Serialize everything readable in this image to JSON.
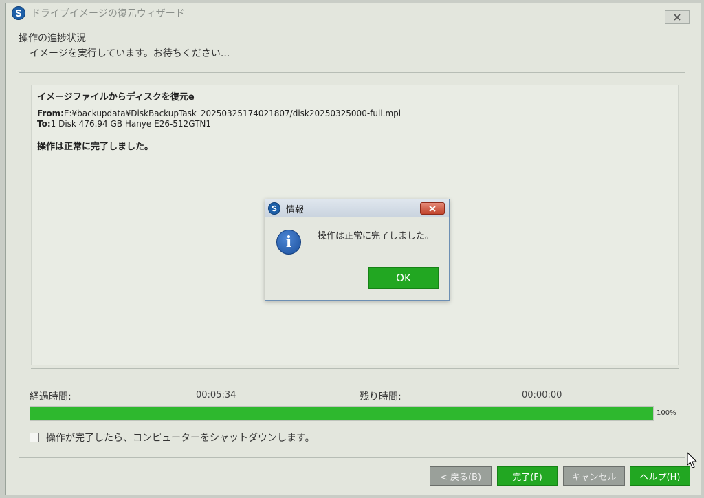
{
  "window": {
    "title": "ドライブイメージの復元ウィザード",
    "close_icon": "close-icon"
  },
  "header": {
    "title": "操作の進捗状況",
    "subtitle": "イメージを実行しています。お待ちください..."
  },
  "panel": {
    "operation_title": "イメージファイルからディスクを復元e",
    "from_label": "From:",
    "from_value": "E:¥backupdata¥DiskBackupTask_20250325174021807/disk20250325000-full.mpi",
    "to_label": "To:",
    "to_value": "1 Disk 476.94 GB Hanye E26-512GTN1",
    "status": "操作は正常に完了しました。"
  },
  "progress": {
    "elapsed_label": "経過時間:",
    "elapsed_value": "00:05:34",
    "remaining_label": "残り時間:",
    "remaining_value": "00:00:00",
    "percent": 100,
    "percent_text": "100%"
  },
  "shutdown_checkbox": {
    "label": "操作が完了したら、コンピューターをシャットダウンします。",
    "checked": false
  },
  "buttons": {
    "back": "< 戻る(B)",
    "finish": "完了(F)",
    "cancel": "キャンセル",
    "help": "ヘルプ(H)"
  },
  "dialog": {
    "title": "情報",
    "message": "操作は正常に完了しました。",
    "ok": "OK",
    "icon": "info-icon"
  },
  "colors": {
    "progress_fill": "#2eb82e",
    "button_green": "#22a722",
    "button_gray": "#9aa09a"
  }
}
